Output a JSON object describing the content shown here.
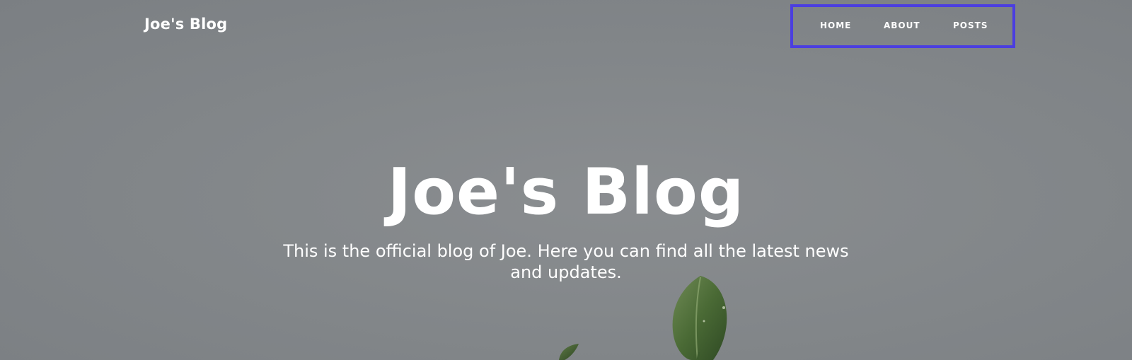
{
  "navbar": {
    "brand": "Joe's Blog",
    "links": [
      {
        "label": "HOME"
      },
      {
        "label": "ABOUT"
      },
      {
        "label": "POSTS"
      }
    ],
    "highlight_color": "#4b3ee0"
  },
  "hero": {
    "title": "Joe's Blog",
    "subtitle": "This is the official blog of Joe. Here you can find all the latest news and updates.",
    "background_color": "#85888b",
    "image_subject": "plant-leaves-icon"
  }
}
